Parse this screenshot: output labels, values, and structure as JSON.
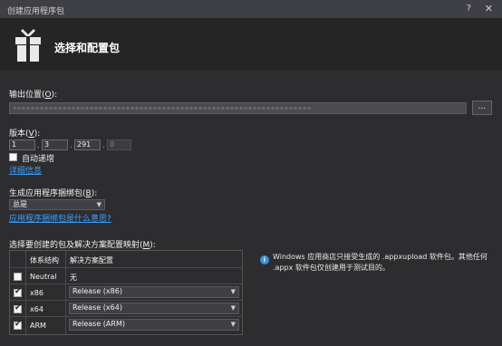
{
  "window": {
    "title": "创建应用程序包",
    "help": "?",
    "close": "✕"
  },
  "header": {
    "title": "选择和配置包"
  },
  "output": {
    "label": "输出位置(",
    "accel": "O",
    "suffix": "):",
    "browse": "..."
  },
  "version": {
    "label": "版本(",
    "accel": "V",
    "suffix": "):",
    "parts": [
      "1",
      "3",
      "291",
      "0"
    ],
    "sep": ".",
    "auto_increment": "自动递增",
    "details_link": "详细信息"
  },
  "bundle": {
    "label": "生成应用程序捆绑包(",
    "accel": "B",
    "suffix": "):",
    "value": "总是",
    "link": "应用程序捆绑包是什么意思?"
  },
  "mapping": {
    "label": "选择要创建的包及解决方案配置映射(",
    "accel": "M",
    "suffix": "):",
    "headers": {
      "arch": "体系结构",
      "config": "解决方案配置"
    },
    "rows": [
      {
        "checked": false,
        "arch": "Neutral",
        "config": "无"
      },
      {
        "checked": true,
        "arch": "x86",
        "config": "Release (x86)"
      },
      {
        "checked": true,
        "arch": "x64",
        "config": "Release (x64)"
      },
      {
        "checked": true,
        "arch": "ARM",
        "config": "Release (ARM)"
      }
    ]
  },
  "info": {
    "icon": "i",
    "text": "Windows 应用商店只接受生成的 .appxupload 软件包。其他任何 .appx 软件包仅创建用于测试目的。"
  }
}
